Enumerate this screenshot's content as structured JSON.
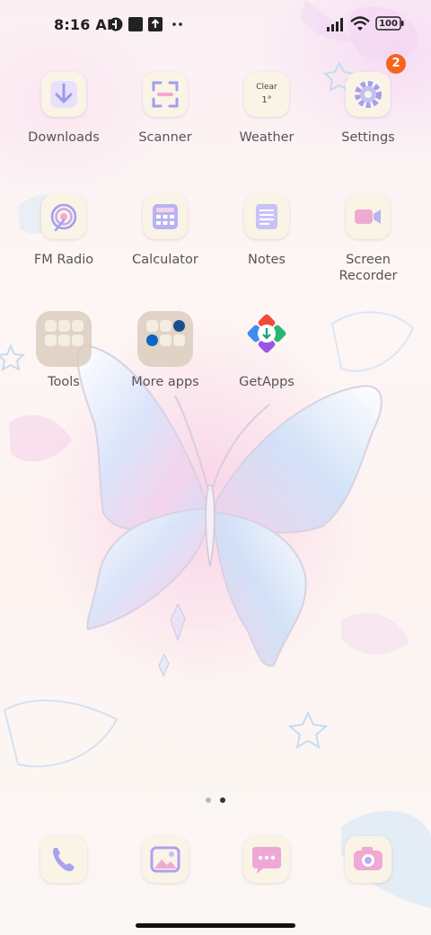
{
  "status_bar": {
    "time": "8:16 AM",
    "battery": "100",
    "icons": [
      "vpn-key-icon",
      "stop-square-icon",
      "upload-box-icon",
      "more-dots-icon",
      "signal-icon",
      "wifi-icon",
      "battery-icon"
    ]
  },
  "apps": [
    {
      "label": "Downloads",
      "icon": "download-arrow-icon"
    },
    {
      "label": "Scanner",
      "icon": "scan-frame-icon"
    },
    {
      "label": "Weather",
      "icon": "weather-widget-icon",
      "condition": "Clear",
      "temp": "1°"
    },
    {
      "label": "Settings",
      "icon": "gear-icon",
      "badge": "2"
    },
    {
      "label": "FM Radio",
      "icon": "radio-waves-icon"
    },
    {
      "label": "Calculator",
      "icon": "calculator-icon"
    },
    {
      "label": "Notes",
      "icon": "notes-icon"
    },
    {
      "label": "Screen\nRecorder",
      "icon": "video-camera-icon"
    },
    {
      "label": "Tools",
      "icon": "folder-icon"
    },
    {
      "label": "More apps",
      "icon": "folder-icon"
    },
    {
      "label": "GetApps",
      "icon": "getapps-icon"
    }
  ],
  "dock": [
    {
      "name": "Phone",
      "icon": "phone-icon"
    },
    {
      "name": "Gallery",
      "icon": "gallery-icon"
    },
    {
      "name": "Messages",
      "icon": "message-bubble-icon"
    },
    {
      "name": "Camera",
      "icon": "camera-icon"
    }
  ],
  "page_indicator": {
    "pages": 2,
    "current": 2
  },
  "colors": {
    "accent_lavender": "#a7a0ee",
    "accent_blue": "#8fb7f0",
    "accent_pink": "#f1a9d2",
    "badge": "#f5651d",
    "label": "#555555"
  }
}
